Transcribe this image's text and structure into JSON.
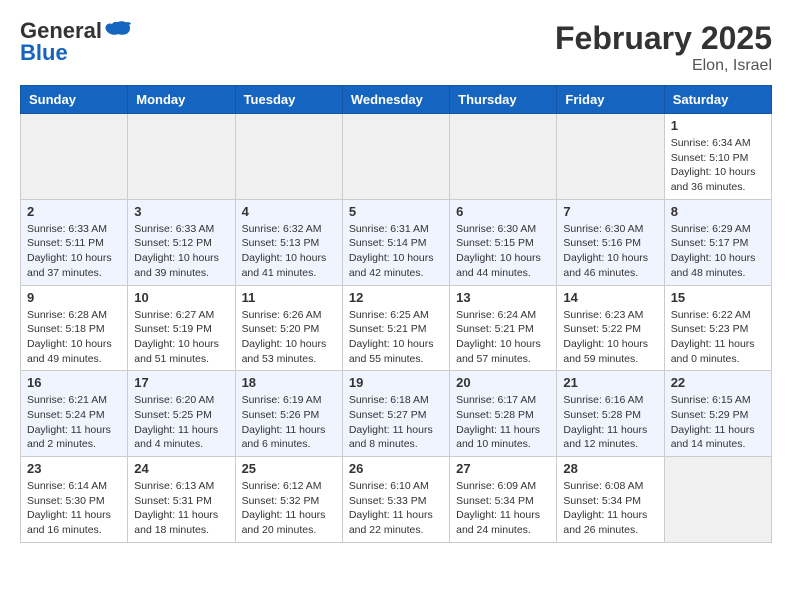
{
  "header": {
    "logo_general": "General",
    "logo_blue": "Blue",
    "month_title": "February 2025",
    "location": "Elon, Israel"
  },
  "calendar": {
    "days_of_week": [
      "Sunday",
      "Monday",
      "Tuesday",
      "Wednesday",
      "Thursday",
      "Friday",
      "Saturday"
    ],
    "weeks": [
      [
        {
          "day": "",
          "info": ""
        },
        {
          "day": "",
          "info": ""
        },
        {
          "day": "",
          "info": ""
        },
        {
          "day": "",
          "info": ""
        },
        {
          "day": "",
          "info": ""
        },
        {
          "day": "",
          "info": ""
        },
        {
          "day": "1",
          "info": "Sunrise: 6:34 AM\nSunset: 5:10 PM\nDaylight: 10 hours and 36 minutes."
        }
      ],
      [
        {
          "day": "2",
          "info": "Sunrise: 6:33 AM\nSunset: 5:11 PM\nDaylight: 10 hours and 37 minutes."
        },
        {
          "day": "3",
          "info": "Sunrise: 6:33 AM\nSunset: 5:12 PM\nDaylight: 10 hours and 39 minutes."
        },
        {
          "day": "4",
          "info": "Sunrise: 6:32 AM\nSunset: 5:13 PM\nDaylight: 10 hours and 41 minutes."
        },
        {
          "day": "5",
          "info": "Sunrise: 6:31 AM\nSunset: 5:14 PM\nDaylight: 10 hours and 42 minutes."
        },
        {
          "day": "6",
          "info": "Sunrise: 6:30 AM\nSunset: 5:15 PM\nDaylight: 10 hours and 44 minutes."
        },
        {
          "day": "7",
          "info": "Sunrise: 6:30 AM\nSunset: 5:16 PM\nDaylight: 10 hours and 46 minutes."
        },
        {
          "day": "8",
          "info": "Sunrise: 6:29 AM\nSunset: 5:17 PM\nDaylight: 10 hours and 48 minutes."
        }
      ],
      [
        {
          "day": "9",
          "info": "Sunrise: 6:28 AM\nSunset: 5:18 PM\nDaylight: 10 hours and 49 minutes."
        },
        {
          "day": "10",
          "info": "Sunrise: 6:27 AM\nSunset: 5:19 PM\nDaylight: 10 hours and 51 minutes."
        },
        {
          "day": "11",
          "info": "Sunrise: 6:26 AM\nSunset: 5:20 PM\nDaylight: 10 hours and 53 minutes."
        },
        {
          "day": "12",
          "info": "Sunrise: 6:25 AM\nSunset: 5:21 PM\nDaylight: 10 hours and 55 minutes."
        },
        {
          "day": "13",
          "info": "Sunrise: 6:24 AM\nSunset: 5:21 PM\nDaylight: 10 hours and 57 minutes."
        },
        {
          "day": "14",
          "info": "Sunrise: 6:23 AM\nSunset: 5:22 PM\nDaylight: 10 hours and 59 minutes."
        },
        {
          "day": "15",
          "info": "Sunrise: 6:22 AM\nSunset: 5:23 PM\nDaylight: 11 hours and 0 minutes."
        }
      ],
      [
        {
          "day": "16",
          "info": "Sunrise: 6:21 AM\nSunset: 5:24 PM\nDaylight: 11 hours and 2 minutes."
        },
        {
          "day": "17",
          "info": "Sunrise: 6:20 AM\nSunset: 5:25 PM\nDaylight: 11 hours and 4 minutes."
        },
        {
          "day": "18",
          "info": "Sunrise: 6:19 AM\nSunset: 5:26 PM\nDaylight: 11 hours and 6 minutes."
        },
        {
          "day": "19",
          "info": "Sunrise: 6:18 AM\nSunset: 5:27 PM\nDaylight: 11 hours and 8 minutes."
        },
        {
          "day": "20",
          "info": "Sunrise: 6:17 AM\nSunset: 5:28 PM\nDaylight: 11 hours and 10 minutes."
        },
        {
          "day": "21",
          "info": "Sunrise: 6:16 AM\nSunset: 5:28 PM\nDaylight: 11 hours and 12 minutes."
        },
        {
          "day": "22",
          "info": "Sunrise: 6:15 AM\nSunset: 5:29 PM\nDaylight: 11 hours and 14 minutes."
        }
      ],
      [
        {
          "day": "23",
          "info": "Sunrise: 6:14 AM\nSunset: 5:30 PM\nDaylight: 11 hours and 16 minutes."
        },
        {
          "day": "24",
          "info": "Sunrise: 6:13 AM\nSunset: 5:31 PM\nDaylight: 11 hours and 18 minutes."
        },
        {
          "day": "25",
          "info": "Sunrise: 6:12 AM\nSunset: 5:32 PM\nDaylight: 11 hours and 20 minutes."
        },
        {
          "day": "26",
          "info": "Sunrise: 6:10 AM\nSunset: 5:33 PM\nDaylight: 11 hours and 22 minutes."
        },
        {
          "day": "27",
          "info": "Sunrise: 6:09 AM\nSunset: 5:34 PM\nDaylight: 11 hours and 24 minutes."
        },
        {
          "day": "28",
          "info": "Sunrise: 6:08 AM\nSunset: 5:34 PM\nDaylight: 11 hours and 26 minutes."
        },
        {
          "day": "",
          "info": ""
        }
      ]
    ]
  }
}
